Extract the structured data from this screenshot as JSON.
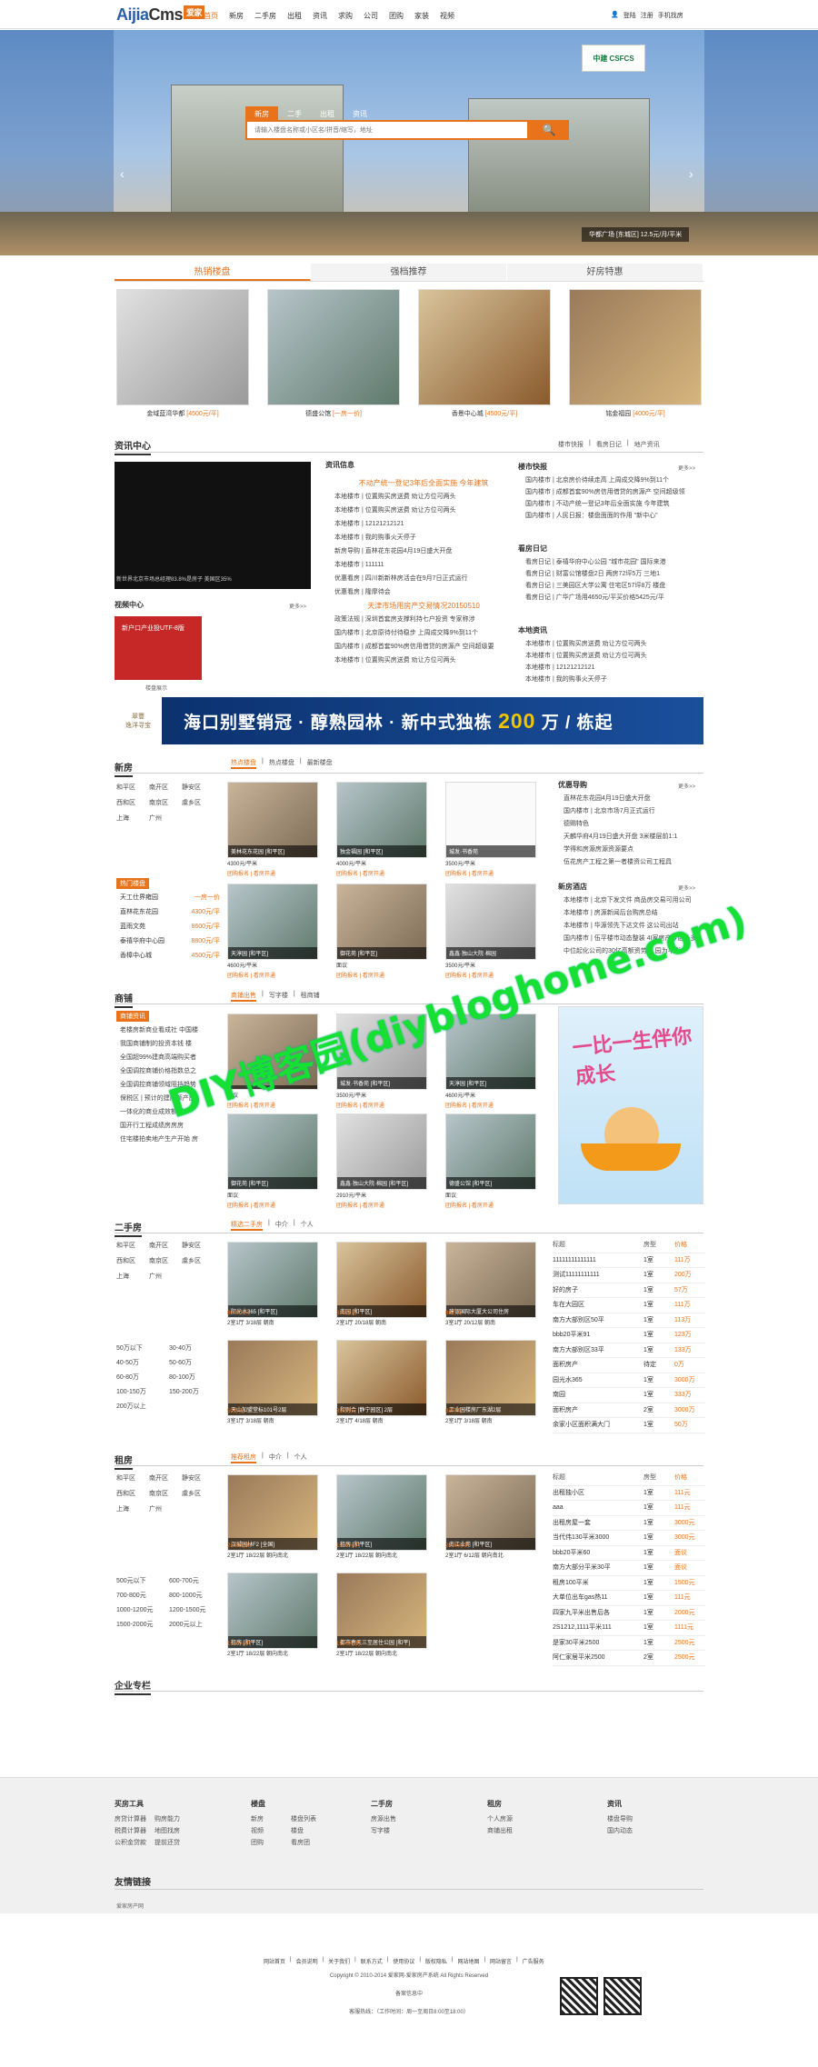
{
  "header": {
    "logo_main": "Aijia",
    "logo_cms": "Cms",
    "logo_badge": "爱家",
    "nav": [
      "首页",
      "新房",
      "二手房",
      "出租",
      "资讯",
      "求购",
      "公司",
      "团购",
      "家装",
      "视频"
    ],
    "login": [
      "登陆",
      "注册",
      "手机找房"
    ]
  },
  "banner": {
    "search_tabs": [
      "新房",
      "二手",
      "出租",
      "资讯"
    ],
    "search_placeholder": "请输入楼盘名称或小区名/拼音/缩写，地址",
    "search_btn": "🔍",
    "caption": "华都广场 [东城区] 12.5元/月/平米",
    "logo_text": "中建 CSFCS"
  },
  "hot": {
    "tabs": [
      "热销楼盘",
      "强档推荐",
      "好房特惠"
    ],
    "items": [
      {
        "name": "金域蓝湾华都",
        "price": "[4500元/平]"
      },
      {
        "name": "德盛公馆",
        "price": "[一房一价]"
      },
      {
        "name": "香景中心城",
        "price": "[4500元/平]"
      },
      {
        "name": "铭金福园",
        "price": "[4000元/平]"
      }
    ]
  },
  "news": {
    "title": "资讯中心",
    "tabs": [
      "楼市快报",
      "看房日记",
      "地产资讯"
    ],
    "dark_caption": "新世界北京市场总经理83.8%是房子 美国区35%",
    "info_title": "资讯信息",
    "headline1": "不动产统一登记3年后全面实施 今年建筑",
    "info_list": [
      "本地楼市 | 位置购买房送费 劝让方位可两头",
      "本地楼市 | 位置购买房送费 劝让方位可两头",
      "本地楼市 | 12121212121",
      "本地楼市 | 我的购事火天停子",
      "新房导购 | 直林花东花园4月19日盛大开盘",
      "本地楼市 | 111111",
      "优惠看房 | 四川新新林房活会在9月7日正式运行",
      "优惠看房 | 隆摩待会"
    ],
    "headline2": "天津市场用房产交易情况20150510",
    "info_list2": [
      "政策法规 | 深圳首套房支撑利持七户投资 专家称涉",
      "国内楼市 | 北京原待付待稳步 上周成交降9%到11个",
      "国内楼市 | 成都首套90%房信用借贷的房源产 空间超级要",
      "本地楼市 | 位置购买房送费 劝让方位可两头"
    ],
    "video_title": "视频中心",
    "video_more": "更多>>",
    "video_caption": "楼盘展示",
    "red_text": "新户口产业投UTF-8版",
    "kuaibao_title": "楼市快报",
    "kuaibao_list": [
      "国内楼市 | 北京房价待续走高 上周成交降9%到11个",
      "国内楼市 | 成都首套90%房信用借贷的房源产 空间超级领",
      "国内楼市 | 不动产统一登记3年后全面实施 今年建筑",
      "国内楼市 | 人民日报：楼盘面面的作用 \"新中心\""
    ],
    "riji_title": "看房日记",
    "riji_list": [
      "看房日记 | 泰禧华府中心公园 \"城市花园\" 国际来港",
      "看房日记 | 财富公馆楼盘2日 两房72坪5万 三地1",
      "看房日记 | 三美园区大学公寓 住宅区57坪8万 楼盘",
      "看房日记 | 广华广场用4650元/平买价格5425元/平"
    ],
    "zixun_title": "本地资讯",
    "zixun_list": [
      "本地楼市 | 位置购买房送费 劝让方位可两头",
      "本地楼市 | 位置购买房送费 劝让方位可两头",
      "本地楼市 | 12121212121",
      "本地楼市 | 我的购事火天停子"
    ],
    "more": "更多>>"
  },
  "ad": {
    "logo_top": "翠豐",
    "logo_bottom": "逸洋寻宝",
    "text_a": "海口别墅销冠 · 醇熟园林 · 新中式独栋",
    "text_num": "200",
    "text_b": "万 / 栋起"
  },
  "xinfang": {
    "title": "新房",
    "tabs": [
      "热点楼盘",
      "热点楼盘",
      "最新楼盘"
    ],
    "areas": [
      "和平区",
      "南开区",
      "静安区",
      "西和区",
      "南京区",
      "虞乡区",
      "上海",
      "广州"
    ],
    "hot_label": "热门楼盘",
    "hot_list": [
      {
        "n": "天工仕界雍园",
        "p": "一房一价"
      },
      {
        "n": "直林花东花园",
        "p": "4300元/平"
      },
      {
        "n": "蓝雨文苑",
        "p": "8600元/平"
      },
      {
        "n": "泰禧华府中心园",
        "p": "8800元/平"
      },
      {
        "n": "香樟中心城",
        "p": "4500元/平"
      }
    ],
    "thumbs": [
      {
        "lbl": "美林花东花园 [和平区]",
        "p": "4300元/平米",
        "tag": "团购报名 | 看房开通"
      },
      {
        "lbl": "独金福园 [和平区]",
        "p": "4000元/平米",
        "tag": "团购报名 | 看房开通"
      },
      {
        "lbl": "城发·书香苑",
        "p": "3500元/平米",
        "tag": "团购报名 | 看房开通"
      },
      {
        "lbl": "天淳园 [和平区]",
        "p": "4600元/平米",
        "tag": "团购报名 | 看房开通"
      },
      {
        "lbl": "御花苑 [和平区]",
        "p": "面议",
        "tag": "团购报名 | 看房开通"
      },
      {
        "lbl": "鑫鑫·独山大院·棉园",
        "p": "3500元/平米",
        "tag": "团购报名 | 看房开通"
      }
    ],
    "yh_title": "优惠导购",
    "yh_list": [
      "直林花东花园4月19日盛大开盘",
      "国内楼市 | 北京市场7月正式运行",
      "德赐特色",
      "天麟华府4月19日盛大开盘 3米楼层前1:1",
      "学得和房源房源资源要点",
      "伍花房产工程之第一者楼资公司工程具"
    ],
    "xj_title": "新房酒店",
    "xj_list": [
      "本地楼市 | 北京下发文件 商品房交易可用公司",
      "本地楼市 | 房源新闻后台购房总结",
      "本地楼市 | 华源领先下达文件 这公司出站",
      "国内楼市 | 伍平楼市动态整装 4I家房产今后补多",
      "中位起化公司的30亿高额资劳家 园为平衡"
    ],
    "more": "更多>>"
  },
  "shangpu": {
    "title": "商铺",
    "tabs": [
      "商铺出售",
      "写字楼",
      "租商铺"
    ],
    "side_label": "商铺资讯",
    "list": [
      "老楼房新商业看成社 中国楼",
      "我国商铺制的投资本钱 楼",
      "全国超99%建商高端购买者",
      "全国调控商铺价格指数总之",
      "全国调控商铺领域阻挡趋势",
      "保税区 | 预计的建商额产房",
      "一体化的商业成效额楼",
      "国开行工程成绩房房房",
      "住宅楼拍卖地产生产开始 房"
    ],
    "thumbs": [
      {
        "lbl": "",
        "p": "面议",
        "tag": "团购报名 | 看房开通"
      },
      {
        "lbl": "城发·书香苑 [和平区]",
        "p": "3500元/平米",
        "tag": "团购报名 | 看房开通"
      },
      {
        "lbl": "天淳园 [和平区]",
        "p": "4600元/平米",
        "tag": "团购报名 | 看房开通"
      },
      {
        "lbl": "御花苑 [和平区]",
        "p": "面议",
        "tag": "团购报名 | 看房开通"
      },
      {
        "lbl": "鑫鑫·独山大院·棉园 [和平区]",
        "p": "2910元/平米",
        "tag": "团购报名 | 看房开通"
      },
      {
        "lbl": "德盛公馆 [和平区]",
        "p": "面议",
        "tag": "团购报名 | 看房开通"
      }
    ],
    "cartoon_text": "一比一生伴你成长"
  },
  "ershou": {
    "title": "二手房",
    "tabs": [
      "精选二手房",
      "中介",
      "个人"
    ],
    "areas": [
      "和平区",
      "南开区",
      "静安区",
      "西和区",
      "南京区",
      "虞乡区",
      "上海",
      "广州"
    ],
    "prices": [
      "50万以下",
      "30-40万",
      "40-50万",
      "50-60万",
      "60-80万",
      "80-100万",
      "100-150万",
      "150-200万",
      "200万以上",
      ""
    ],
    "thumbs": [
      {
        "lbl": "阳光水365 [和平区]",
        "p": "8000万元",
        "tag": "2室1厅 3/18层 朝南"
      },
      {
        "lbl": "南园 [和平区]",
        "p": "333万元",
        "tag": "2室1厅 20/18层 朝南"
      },
      {
        "lbl": "建银国际大厦大公司住房",
        "p": "88万元",
        "tag": "3室1厅 20/12层 朝南"
      },
      {
        "lbl": "天山加盟堂标101号2层",
        "p": "50万元",
        "tag": "3室1厅 3/18层 朝南"
      },
      {
        "lbl": "和则合 [静宁园区] 2层",
        "p": "333万元",
        "tag": "2室1厅 4/18层 朝南"
      },
      {
        "lbl": "工业园楼房厂东湖2层",
        "p": "88万元",
        "tag": "2室1厅 3/18层 朝南"
      }
    ],
    "table_head": [
      "标题",
      "房型",
      "价格"
    ],
    "table": [
      [
        "11111111111111",
        "1室",
        "111万"
      ],
      [
        "测试11111111111",
        "1室",
        "200万"
      ],
      [
        "好的房子",
        "1室",
        "57万"
      ],
      [
        "车在大园区",
        "1室",
        "111万"
      ],
      [
        "南方大部别区50平",
        "1室",
        "113万"
      ],
      [
        "bbb20平米91",
        "1室",
        "123万"
      ],
      [
        "南方大部别区33平",
        "1室",
        "133万"
      ],
      [
        "面积房产",
        "待定",
        "0万"
      ],
      [
        "园光水365",
        "1室",
        "3000万"
      ],
      [
        "南园",
        "1室",
        "333万"
      ],
      [
        "面积房产",
        "2室",
        "3000万"
      ],
      [
        "余家小区面积满大门",
        "1室",
        "50万"
      ]
    ]
  },
  "zufang": {
    "title": "租房",
    "tabs": [
      "推荐租房",
      "中介",
      "个人"
    ],
    "areas": [
      "和平区",
      "南开区",
      "静安区",
      "西和区",
      "南京区",
      "虞乡区",
      "上海",
      "广州"
    ],
    "prices": [
      "500元以下",
      "600-700元",
      "700-800元",
      "800-1000元",
      "1000-1200元",
      "1200-1500元",
      "1500-2000元",
      "2000元以上"
    ],
    "thumbs": [
      {
        "lbl": "汉城园林F2 [全国]",
        "p": "2500元/月",
        "tag": "2室1厅 18/22层 朝向南北"
      },
      {
        "lbl": "租房 [和平区]",
        "p": "1500元/月",
        "tag": "2室1厅 18/22层 朝向南北"
      },
      {
        "lbl": "南江业苑 [和平区]",
        "p": "2500元/月",
        "tag": "2室1厅 6/12层 朝向南北"
      },
      {
        "lbl": "租房 [和平区]",
        "p": "1500元/月",
        "tag": "2室1厅 18/22层 朝向南北"
      },
      {
        "lbl": "都市春天三至居住公园 [和平]",
        "p": "1500元/月",
        "tag": "2室1厅 18/22层 朝向南北"
      }
    ],
    "table_head": [
      "标题",
      "房型",
      "价格"
    ],
    "table": [
      [
        "出租独小区",
        "1室",
        "111元"
      ],
      [
        "aaa",
        "1室",
        "111元"
      ],
      [
        "出租房屋一套",
        "1室",
        "3000元"
      ],
      [
        "当代伟130平米3000",
        "1室",
        "3000元"
      ],
      [
        "bbb20平米60",
        "1室",
        "面议"
      ],
      [
        "南方大部分平米30平",
        "1室",
        "面议"
      ],
      [
        "租房100平米",
        "1室",
        "1500元"
      ],
      [
        "大单位出车gas热11",
        "1室",
        "111元"
      ],
      [
        "四家九平米出售后各",
        "1室",
        "2000元"
      ],
      [
        "2S1212,1111平米111",
        "1室",
        "1111元"
      ],
      [
        "是家30平米2500",
        "1室",
        "2500元"
      ],
      [
        "阿仁家居平米2500",
        "2室",
        "2500元"
      ]
    ]
  },
  "company": {
    "title": "企业专栏"
  },
  "footer": {
    "cols": [
      {
        "h": "买房工具",
        "items": [
          "房贷计算器",
          "购房能力",
          "税费计算器",
          "地图找房",
          "公积金贷款",
          "提前还贷"
        ]
      },
      {
        "h": "楼盘",
        "items": [
          "新房",
          "楼盘列表",
          "视频",
          "楼盘",
          "团购",
          "看房团"
        ]
      },
      {
        "h": "二手房",
        "items": [
          "房源出售",
          "写字楼"
        ]
      },
      {
        "h": "租房",
        "items": [
          "个人房源",
          "商铺出租"
        ]
      },
      {
        "h": "资讯",
        "items": [
          "楼盘导购",
          "国内动态"
        ]
      }
    ],
    "friend_title": "友情链接",
    "friend_item": "爱家房产网",
    "links": [
      "网站首页",
      "会员说明",
      "关于我们",
      "联系方式",
      "使用协议",
      "版权隐私",
      "网站地图",
      "网站留言",
      "广告服务"
    ],
    "copyright": "Copyright © 2010-2014 爱家网-爱家房产系统 All Rights Reserved",
    "icp": "备案信息中",
    "phone": "客服热线：（工作时间：周一至周日8:00至18:00）"
  },
  "watermark": "DIY博客园(diybloghome.com)"
}
